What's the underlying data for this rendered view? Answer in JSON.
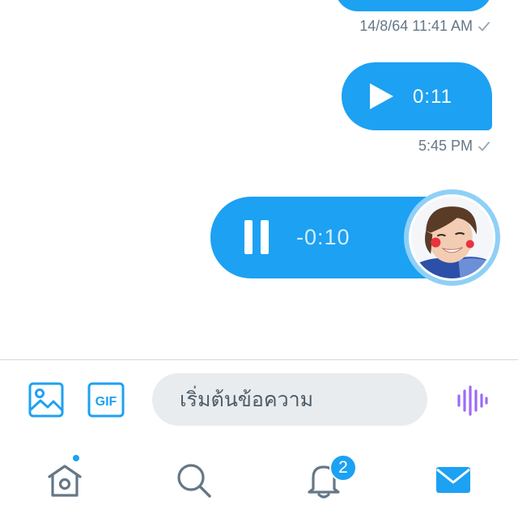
{
  "colors": {
    "accent": "#1DA1F2",
    "meta_text": "#657786",
    "voice_icon": "#9B6BF7"
  },
  "messages": [
    {
      "type": "previous-bubble",
      "timestamp": "14/8/64 11:41 AM",
      "status_icon": "check-icon"
    },
    {
      "type": "voice",
      "state": "paused",
      "control_icon": "play-icon",
      "duration": "0:11",
      "timestamp": "5:45 PM",
      "status_icon": "check-icon"
    },
    {
      "type": "voice",
      "state": "playing",
      "control_icon": "pause-icon",
      "duration": "-0:10",
      "avatar": "user-avatar"
    }
  ],
  "composer": {
    "image_icon": "image-icon",
    "gif_label": "GIF",
    "placeholder": "เริ่มต้นข้อความ",
    "voice_icon": "voice-waveform-icon"
  },
  "tabbar": {
    "items": [
      {
        "name": "home",
        "icon": "home-icon",
        "has_dot": true
      },
      {
        "name": "search",
        "icon": "search-icon"
      },
      {
        "name": "notifications",
        "icon": "bell-icon",
        "badge": "2"
      },
      {
        "name": "messages",
        "icon": "mail-icon",
        "active": true
      }
    ]
  }
}
